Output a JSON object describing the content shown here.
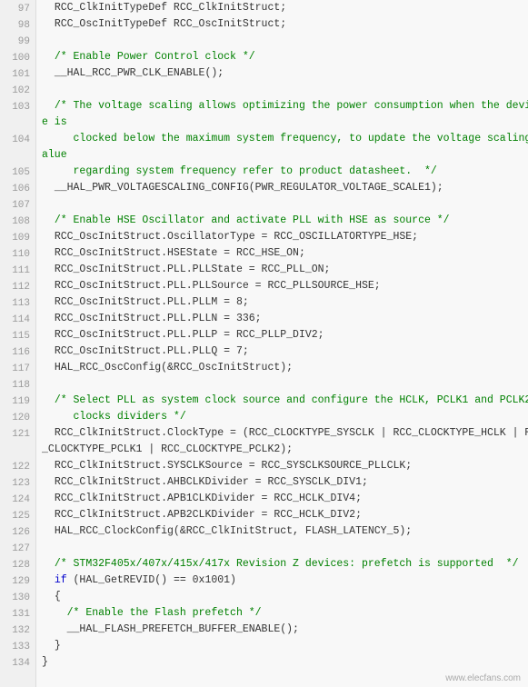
{
  "lines": [
    {
      "num": 97,
      "text": "  RCC_ClkInitTypeDef RCC_ClkInitStruct;",
      "indent": 2
    },
    {
      "num": 98,
      "text": "  RCC_OscInitTypeDef RCC_OscInitStruct;",
      "indent": 2
    },
    {
      "num": 99,
      "text": "",
      "indent": 0
    },
    {
      "num": 100,
      "text": "  /* Enable Power Control clock */",
      "indent": 2,
      "type": "comment"
    },
    {
      "num": 101,
      "text": "  __HAL_RCC_PWR_CLK_ENABLE();",
      "indent": 2
    },
    {
      "num": 102,
      "text": "",
      "indent": 0
    },
    {
      "num": 103,
      "text": "  /* The voltage scaling allows optimizing the power consumption when the devic",
      "indent": 2,
      "type": "comment"
    },
    {
      "num": "103b",
      "text": "e is",
      "indent": 0,
      "type": "comment",
      "continuation": true
    },
    {
      "num": 104,
      "text": "     clocked below the maximum system frequency, to update the voltage scaling v",
      "indent": 5,
      "type": "comment"
    },
    {
      "num": "104b",
      "text": "alue",
      "indent": 0,
      "type": "comment",
      "continuation": true
    },
    {
      "num": 105,
      "text": "     regarding system frequency refer to product datasheet.  */",
      "indent": 5,
      "type": "comment"
    },
    {
      "num": 106,
      "text": "  __HAL_PWR_VOLTAGESCALING_CONFIG(PWR_REGULATOR_VOLTAGE_SCALE1);",
      "indent": 2
    },
    {
      "num": 107,
      "text": "",
      "indent": 0
    },
    {
      "num": 108,
      "text": "  /* Enable HSE Oscillator and activate PLL with HSE as source */",
      "indent": 2,
      "type": "comment"
    },
    {
      "num": 109,
      "text": "  RCC_OscInitStruct.OscillatorType = RCC_OSCILLATORTYPE_HSE;",
      "indent": 2
    },
    {
      "num": 110,
      "text": "  RCC_OscInitStruct.HSEState = RCC_HSE_ON;",
      "indent": 2
    },
    {
      "num": 111,
      "text": "  RCC_OscInitStruct.PLL.PLLState = RCC_PLL_ON;",
      "indent": 2
    },
    {
      "num": 112,
      "text": "  RCC_OscInitStruct.PLL.PLLSource = RCC_PLLSOURCE_HSE;",
      "indent": 2
    },
    {
      "num": 113,
      "text": "  RCC_OscInitStruct.PLL.PLLM = 8;",
      "indent": 2
    },
    {
      "num": 114,
      "text": "  RCC_OscInitStruct.PLL.PLLN = 336;",
      "indent": 2
    },
    {
      "num": 115,
      "text": "  RCC_OscInitStruct.PLL.PLLP = RCC_PLLP_DIV2;",
      "indent": 2
    },
    {
      "num": 116,
      "text": "  RCC_OscInitStruct.PLL.PLLQ = 7;",
      "indent": 2
    },
    {
      "num": 117,
      "text": "  HAL_RCC_OscConfig(&RCC_OscInitStruct);",
      "indent": 2
    },
    {
      "num": 118,
      "text": "",
      "indent": 0
    },
    {
      "num": 119,
      "text": "  /* Select PLL as system clock source and configure the HCLK, PCLK1 and PCLK2",
      "indent": 2,
      "type": "comment"
    },
    {
      "num": 120,
      "text": "     clocks dividers */",
      "indent": 5,
      "type": "comment"
    },
    {
      "num": 121,
      "text": "  RCC_ClkInitStruct.ClockType = (RCC_CLOCKTYPE_SYSCLK | RCC_CLOCKTYPE_HCLK | RCC",
      "indent": 2
    },
    {
      "num": "121b",
      "text": "_CLOCKTYPE_PCLK1 | RCC_CLOCKTYPE_PCLK2);",
      "indent": 0,
      "continuation": true
    },
    {
      "num": 122,
      "text": "  RCC_ClkInitStruct.SYSCLKSource = RCC_SYSCLKSOURCE_PLLCLK;",
      "indent": 2
    },
    {
      "num": 123,
      "text": "  RCC_ClkInitStruct.AHBCLKDivider = RCC_SYSCLK_DIV1;",
      "indent": 2
    },
    {
      "num": 124,
      "text": "  RCC_ClkInitStruct.APB1CLKDivider = RCC_HCLK_DIV4;",
      "indent": 2
    },
    {
      "num": 125,
      "text": "  RCC_ClkInitStruct.APB2CLKDivider = RCC_HCLK_DIV2;",
      "indent": 2
    },
    {
      "num": 126,
      "text": "  HAL_RCC_ClockConfig(&RCC_ClkInitStruct, FLASH_LATENCY_5);",
      "indent": 2
    },
    {
      "num": 127,
      "text": "",
      "indent": 0
    },
    {
      "num": 128,
      "text": "  /* STM32F405x/407x/415x/417x Revision Z devices: prefetch is supported  */",
      "indent": 2,
      "type": "comment"
    },
    {
      "num": 129,
      "text": "  if (HAL_GetREVID() == 0x1001)",
      "indent": 2
    },
    {
      "num": 130,
      "text": "  {",
      "indent": 2
    },
    {
      "num": 131,
      "text": "    /* Enable the Flash prefetch */",
      "indent": 4,
      "type": "comment"
    },
    {
      "num": 132,
      "text": "    __HAL_FLASH_PREFETCH_BUFFER_ENABLE();",
      "indent": 4
    },
    {
      "num": 133,
      "text": "  }",
      "indent": 2
    },
    {
      "num": 134,
      "text": "}",
      "indent": 0
    }
  ],
  "watermark": "www.elecfans.com"
}
